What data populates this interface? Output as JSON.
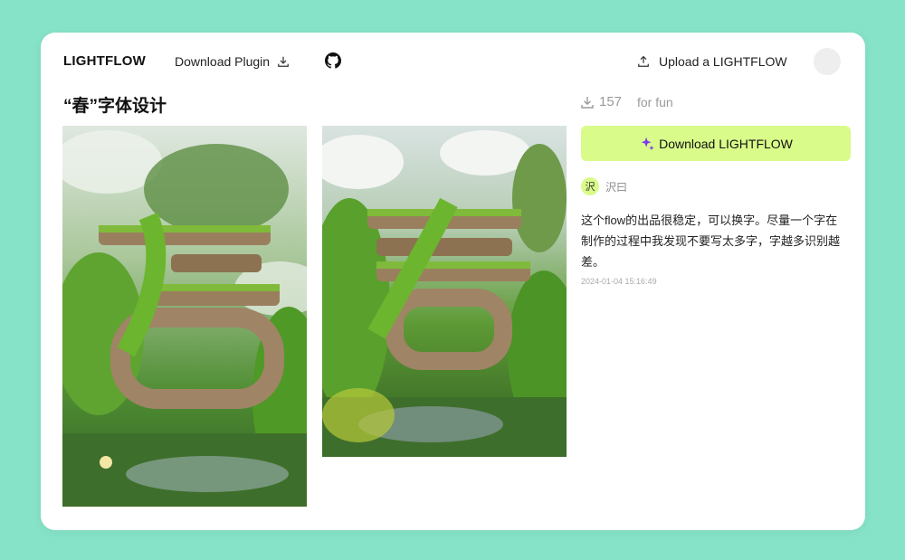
{
  "nav": {
    "logo": "LIGHTFLOW",
    "download_plugin": "Download Plugin",
    "upload": "Upload a LIGHTFLOW"
  },
  "work": {
    "title": "“春”字体设计",
    "downloads": "157",
    "tag": "for fun"
  },
  "sidebar": {
    "download_button": "Download LIGHTFLOW",
    "author_initial": "沢",
    "author_name": "沢曰",
    "description": "这个flow的出品很稳定，可以换字。尽量一个字在制作的过程中我发现不要写太多字，字越多识别越差。",
    "timestamp": "2024-01-04 15:16:49"
  },
  "icons": {
    "download": "download-icon",
    "github": "github-icon",
    "upload": "upload-icon",
    "sparkle": "sparkle-icon"
  },
  "colors": {
    "background": "#86e3c7",
    "accent": "#d9fb8a",
    "sparkle": "#7c3aed"
  }
}
